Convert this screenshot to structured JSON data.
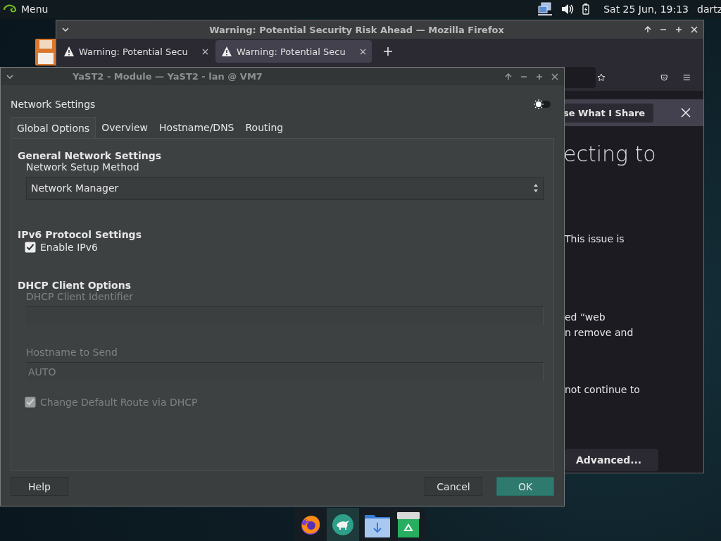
{
  "panel": {
    "menu": "Menu",
    "clock": "Sat 25 Jun, 19:13",
    "user": "dartz"
  },
  "firefox": {
    "title": "Warning: Potential Security Risk Ahead — Mozilla Firefox",
    "tabs": [
      {
        "label": "Warning: Potential Secu",
        "selected": false
      },
      {
        "label": "Warning: Potential Secu",
        "selected": true
      }
    ],
    "share_button": "se What I Share",
    "heading": "ecting to",
    "text_lines": [
      "This issue is",
      "ed “web",
      "n remove and",
      "not continue to"
    ],
    "advanced_button": "Advanced..."
  },
  "yast": {
    "title": "YaST2 - Module — YaST2 - lan @ VM7",
    "heading": "Network Settings",
    "tabs": [
      {
        "label": "Global Options",
        "selected": true
      },
      {
        "label": "Overview",
        "selected": false
      },
      {
        "label": "Hostname/DNS",
        "selected": false
      },
      {
        "label": "Routing",
        "selected": false
      }
    ],
    "form": [
      {
        "kind": "heading",
        "text": "General Network Settings"
      },
      {
        "kind": "label",
        "text": "Network Setup Method",
        "disabled": false
      },
      {
        "kind": "combo",
        "value": "Network Manager"
      },
      {
        "kind": "heading",
        "text": "IPv6 Protocol Settings"
      },
      {
        "kind": "checkbox",
        "label": "Enable IPv6",
        "checked": true,
        "disabled": false
      },
      {
        "kind": "heading",
        "text": "DHCP Client Options"
      },
      {
        "kind": "label",
        "text": "DHCP Client Identifier",
        "disabled": true
      },
      {
        "kind": "field",
        "disabled": true
      },
      {
        "kind": "label",
        "text": "Hostname to Send",
        "disabled": true
      },
      {
        "kind": "field",
        "value": "AUTO",
        "disabled": true
      },
      {
        "kind": "checkbox",
        "label": "Change Default Route via DHCP",
        "checked": true,
        "disabled": true
      }
    ],
    "buttons": [
      {
        "label": "Help",
        "primary": false
      },
      {
        "label": "Cancel",
        "primary": false
      },
      {
        "label": "OK",
        "primary": true
      }
    ]
  }
}
